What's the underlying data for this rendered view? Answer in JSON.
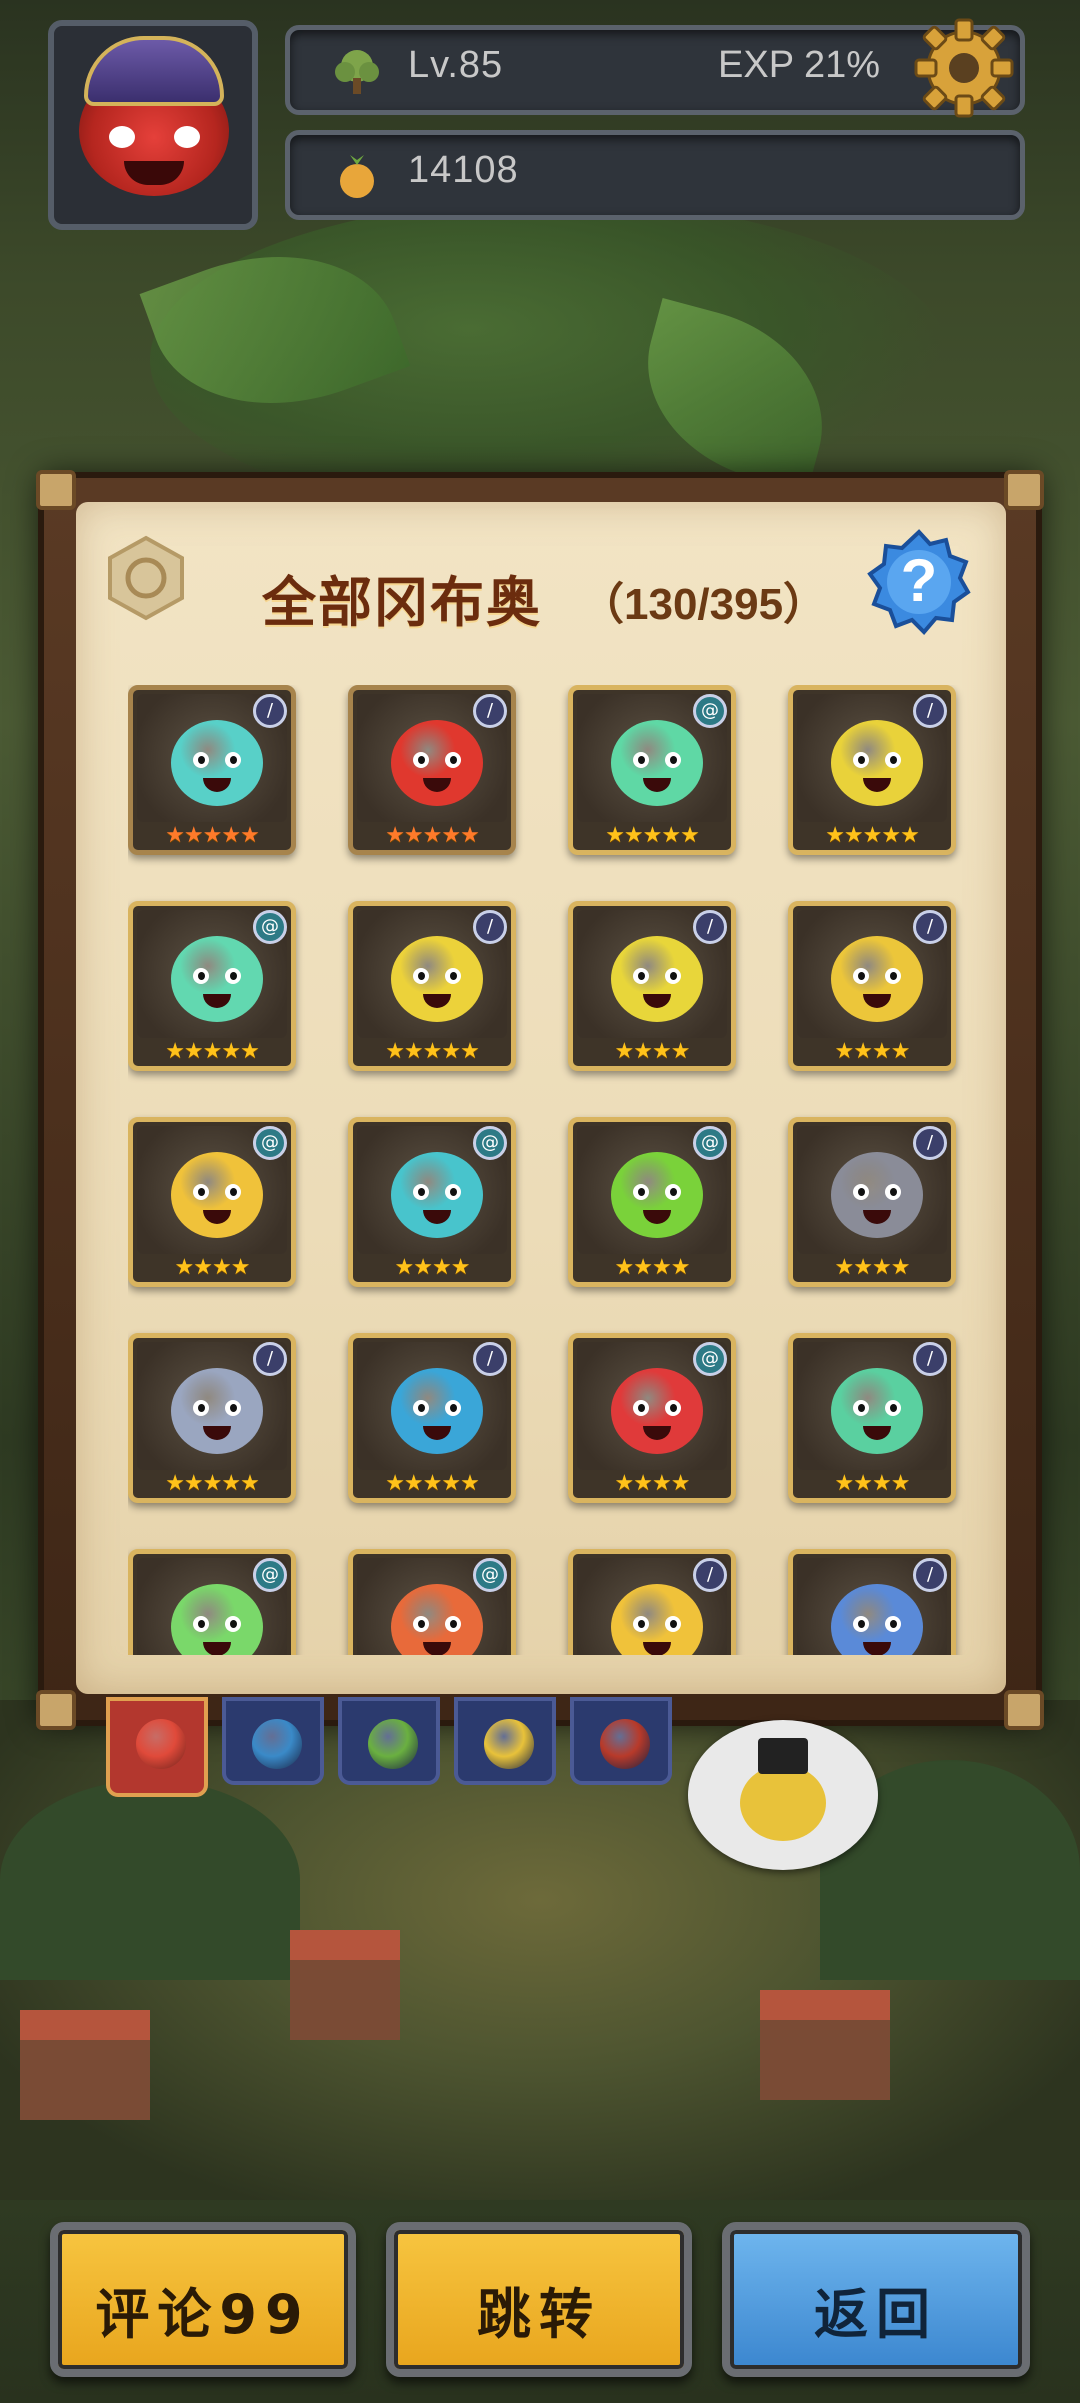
{
  "hud": {
    "level_label": "Lv.85",
    "exp_label": "EXP 21%",
    "gold_amount": "14108"
  },
  "panel": {
    "title": "全部冈布奥",
    "count": "（130/395）",
    "help_symbol": "?"
  },
  "cards": [
    {
      "color": "#58d0c8",
      "badge": "shield",
      "rarity": "red",
      "stars": "★★★★★"
    },
    {
      "color": "#e0382e",
      "badge": "sword",
      "rarity": "red",
      "stars": "★★★★★"
    },
    {
      "color": "#5fd8a5",
      "badge": "swirl",
      "rarity": "gold",
      "stars": "★★★★★"
    },
    {
      "color": "#e9d23a",
      "badge": "sword",
      "rarity": "gold",
      "stars": "★★★★★"
    },
    {
      "color": "#62d8b0",
      "badge": "swirl",
      "rarity": "gold",
      "stars": "★★★★★"
    },
    {
      "color": "#ecd23a",
      "badge": "sword",
      "rarity": "gold",
      "stars": "★★★★★"
    },
    {
      "color": "#e8d63a",
      "badge": "sword",
      "rarity": "gold",
      "stars": "★★★★"
    },
    {
      "color": "#ecc63a",
      "badge": "sword",
      "rarity": "gold",
      "stars": "★★★★"
    },
    {
      "color": "#f0c23a",
      "badge": "swirl",
      "rarity": "gold",
      "stars": "★★★★"
    },
    {
      "color": "#48c4cc",
      "badge": "swirl",
      "rarity": "gold",
      "stars": "★★★★"
    },
    {
      "color": "#7ad23a",
      "badge": "swirl",
      "rarity": "gold",
      "stars": "★★★★"
    },
    {
      "color": "#8a8c98",
      "badge": "sword",
      "rarity": "gold",
      "stars": "★★★★"
    },
    {
      "color": "#9aa6c0",
      "badge": "sword",
      "rarity": "gold",
      "stars": "★★★★★"
    },
    {
      "color": "#3aa6d8",
      "badge": "sword",
      "rarity": "gold",
      "stars": "★★★★★"
    },
    {
      "color": "#e03a3a",
      "badge": "swirl",
      "rarity": "gold",
      "stars": "★★★★"
    },
    {
      "color": "#5ad0a0",
      "badge": "sword",
      "rarity": "gold",
      "stars": "★★★★"
    },
    {
      "color": "#7ad86a",
      "badge": "swirl",
      "rarity": "gold",
      "stars": ""
    },
    {
      "color": "#e86a3a",
      "badge": "swirl",
      "rarity": "gold",
      "stars": ""
    },
    {
      "color": "#f0c23a",
      "badge": "sword",
      "rarity": "gold",
      "stars": ""
    },
    {
      "color": "#5a8ad8",
      "badge": "sword",
      "rarity": "gold",
      "stars": ""
    }
  ],
  "tabs": [
    {
      "color": "#e04a3a",
      "active": true
    },
    {
      "color": "#3a8ac8",
      "active": false
    },
    {
      "color": "#6ab040",
      "active": false
    },
    {
      "color": "#e8c23a",
      "active": false
    },
    {
      "color": "#b83a2a",
      "active": false
    }
  ],
  "buttons": {
    "comment": "评论99",
    "jump": "跳转",
    "back": "返回"
  },
  "colors": {
    "button_yellow": "#f2b834",
    "button_blue": "#4f9ee0",
    "title_brown": "#6b2c0e"
  }
}
